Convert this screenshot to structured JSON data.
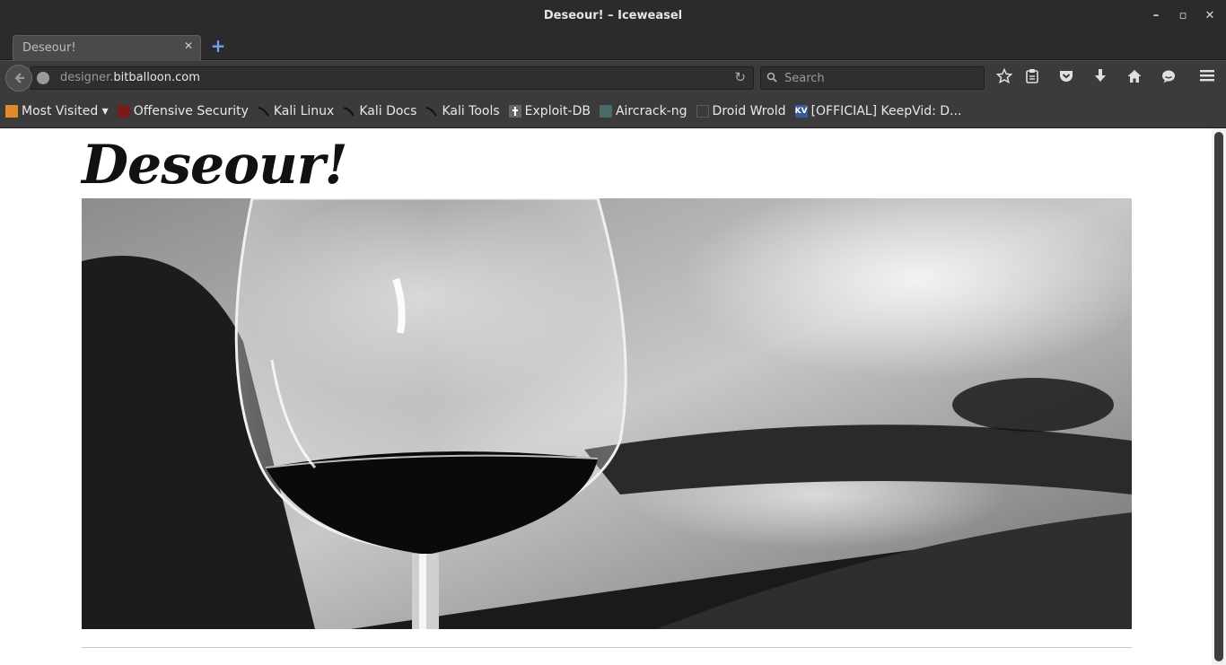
{
  "window": {
    "title": "Deseour! – Iceweasel",
    "controls": [
      "–",
      "▫",
      "✕"
    ]
  },
  "tabs": [
    {
      "title": "Deseour!",
      "close": "✕",
      "active": true
    }
  ],
  "new_tab": "+",
  "navbar": {
    "url_prefix": "designer.",
    "url_domain": "bitballoon.com",
    "reload_glyph": "↻",
    "search_placeholder": "Search",
    "icons": [
      "star-icon",
      "reading-list-icon",
      "pocket-icon",
      "download-icon",
      "home-icon",
      "chat-icon",
      "menu-icon"
    ]
  },
  "bookmarks": [
    {
      "label": "Most Visited ▾",
      "icon": "most-visited-icon",
      "color": "#e08a2a"
    },
    {
      "label": "Offensive Security",
      "icon": "offsec-icon",
      "color": "#7a1a1a"
    },
    {
      "label": "Kali Linux",
      "icon": "kali-icon",
      "color": "#222222"
    },
    {
      "label": "Kali Docs",
      "icon": "kali-icon",
      "color": "#222222"
    },
    {
      "label": "Kali Tools",
      "icon": "kali-icon",
      "color": "#222222"
    },
    {
      "label": "Exploit-DB",
      "icon": "exploitdb-icon",
      "color": "#555555"
    },
    {
      "label": "Aircrack-ng",
      "icon": "aircrack-icon",
      "color": "#4a6a6a"
    },
    {
      "label": "Droid Wrold",
      "icon": "blank-page-icon",
      "color": "#4a4a4a"
    },
    {
      "label": "[OFFICIAL] KeepVid: D...",
      "icon": "keepvid-icon",
      "color": "#3a5a9a"
    }
  ],
  "page": {
    "title": "Deseour!"
  },
  "colors": {
    "chrome_dark": "#2b2b2b",
    "toolbar": "#3b3b3b",
    "accent_blue": "#6aa3f0"
  }
}
